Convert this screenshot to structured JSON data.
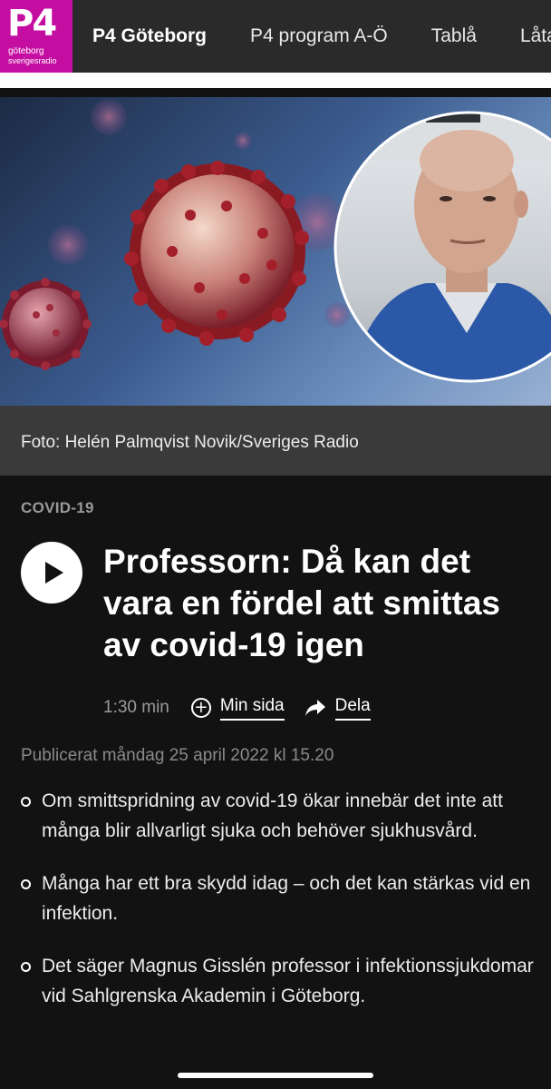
{
  "header": {
    "logo": {
      "text": "P4",
      "sub1": "göteborg",
      "sub2": "sverigesradio"
    },
    "nav": [
      {
        "label": "P4 Göteborg"
      },
      {
        "label": "P4 program A-Ö"
      },
      {
        "label": "Tablå"
      },
      {
        "label": "Låtar"
      }
    ]
  },
  "hero": {
    "caption": "Foto: Helén Palmqvist Novik/Sveriges Radio"
  },
  "article": {
    "category": "COVID-19",
    "title": "Professorn: Då kan det vara en fördel att smittas av covid-19 igen",
    "duration": "1:30 min",
    "my_page_label": "Min sida",
    "share_label": "Dela",
    "published": "Publicerat måndag 25 april 2022 kl 15.20",
    "bullets": [
      "Om smittspridning av covid-19 ökar innebär det inte att många blir allvarligt sjuka och behöver sjukhusvård.",
      "Många har ett bra skydd idag – och det kan stärkas vid en infektion.",
      "Det säger Magnus Gisslén professor i infektionssjukdomar vid Sahlgrenska Akademin i Göteborg."
    ]
  },
  "colors": {
    "brand": "#c40da1",
    "background": "#121212",
    "topbar": "#2a2a2a",
    "caption_bg": "#3a3a3a"
  }
}
